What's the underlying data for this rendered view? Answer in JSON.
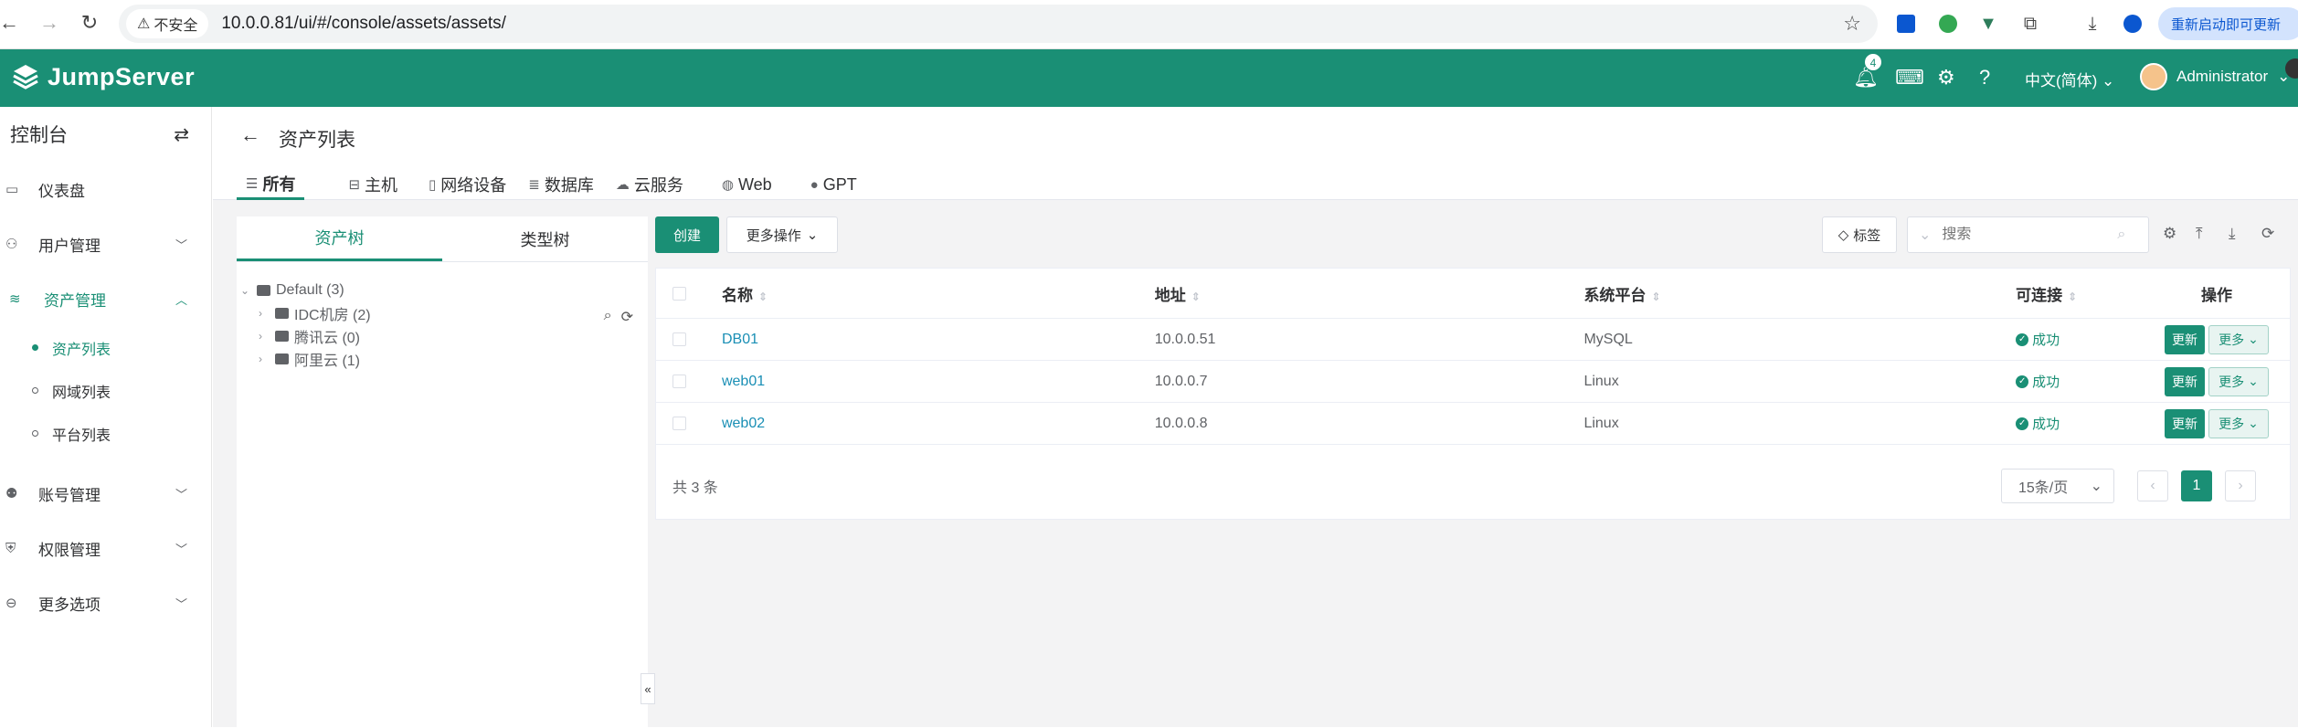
{
  "browser": {
    "security_label": "不安全",
    "url": "10.0.0.81/ui/#/console/assets/assets/",
    "update_label": "重新启动即可更新"
  },
  "topbar": {
    "app_name": "JumpServer",
    "notification_count": "4",
    "language": "中文(简体)",
    "user": "Administrator"
  },
  "sidebar": {
    "title": "控制台",
    "items": [
      {
        "label": "仪表盘",
        "icon": "dashboard-icon"
      },
      {
        "label": "用户管理",
        "icon": "users-icon"
      },
      {
        "label": "资产管理",
        "icon": "assets-icon"
      },
      {
        "label": "账号管理",
        "icon": "accounts-icon"
      },
      {
        "label": "权限管理",
        "icon": "permissions-icon"
      },
      {
        "label": "更多选项",
        "icon": "more-options-icon"
      }
    ],
    "asset_sub": [
      "资产列表",
      "网域列表",
      "平台列表"
    ]
  },
  "page": {
    "title": "资产列表",
    "tabs": [
      "所有",
      "主机",
      "网络设备",
      "数据库",
      "云服务",
      "Web",
      "GPT"
    ]
  },
  "tree": {
    "tabs": [
      "资产树",
      "类型树"
    ],
    "root": "Default (3)",
    "children": [
      "IDC机房 (2)",
      "腾讯云 (0)",
      "阿里云 (1)"
    ]
  },
  "toolbar": {
    "create": "创建",
    "more_actions": "更多操作",
    "tag": "标签",
    "search_placeholder": "搜索"
  },
  "table": {
    "columns": [
      "名称",
      "地址",
      "系统平台",
      "可连接",
      "操作"
    ],
    "rows": [
      {
        "name": "DB01",
        "address": "10.0.0.51",
        "platform": "MySQL",
        "status": "成功"
      },
      {
        "name": "web01",
        "address": "10.0.0.7",
        "platform": "Linux",
        "status": "成功"
      },
      {
        "name": "web02",
        "address": "10.0.0.8",
        "platform": "Linux",
        "status": "成功"
      }
    ],
    "update_btn": "更新",
    "more_btn": "更多"
  },
  "pagination": {
    "total": "共 3 条",
    "page_size": "15条/页",
    "current_page": "1"
  },
  "colors": {
    "brand": "#1a8f75"
  }
}
